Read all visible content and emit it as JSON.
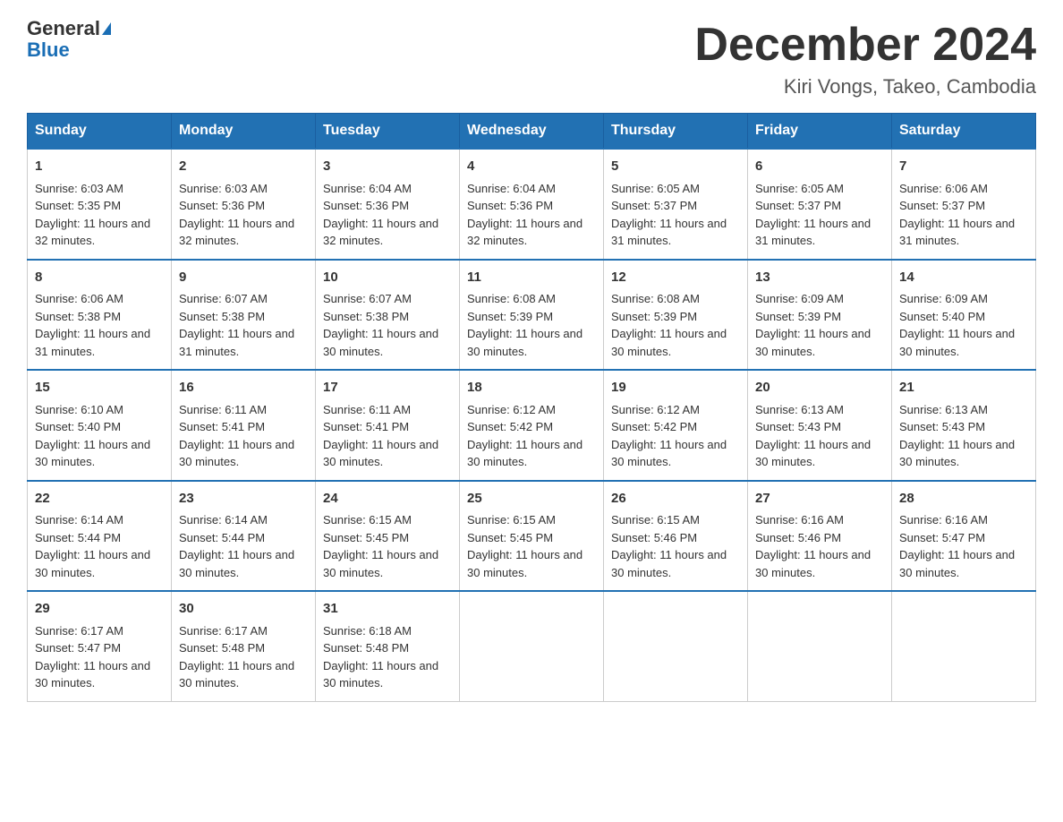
{
  "logo": {
    "line1": "General",
    "line2": "Blue"
  },
  "header": {
    "month_title": "December 2024",
    "location": "Kiri Vongs, Takeo, Cambodia"
  },
  "weekdays": [
    "Sunday",
    "Monday",
    "Tuesday",
    "Wednesday",
    "Thursday",
    "Friday",
    "Saturday"
  ],
  "weeks": [
    [
      {
        "day": "1",
        "sunrise": "6:03 AM",
        "sunset": "5:35 PM",
        "daylight": "11 hours and 32 minutes."
      },
      {
        "day": "2",
        "sunrise": "6:03 AM",
        "sunset": "5:36 PM",
        "daylight": "11 hours and 32 minutes."
      },
      {
        "day": "3",
        "sunrise": "6:04 AM",
        "sunset": "5:36 PM",
        "daylight": "11 hours and 32 minutes."
      },
      {
        "day": "4",
        "sunrise": "6:04 AM",
        "sunset": "5:36 PM",
        "daylight": "11 hours and 32 minutes."
      },
      {
        "day": "5",
        "sunrise": "6:05 AM",
        "sunset": "5:37 PM",
        "daylight": "11 hours and 31 minutes."
      },
      {
        "day": "6",
        "sunrise": "6:05 AM",
        "sunset": "5:37 PM",
        "daylight": "11 hours and 31 minutes."
      },
      {
        "day": "7",
        "sunrise": "6:06 AM",
        "sunset": "5:37 PM",
        "daylight": "11 hours and 31 minutes."
      }
    ],
    [
      {
        "day": "8",
        "sunrise": "6:06 AM",
        "sunset": "5:38 PM",
        "daylight": "11 hours and 31 minutes."
      },
      {
        "day": "9",
        "sunrise": "6:07 AM",
        "sunset": "5:38 PM",
        "daylight": "11 hours and 31 minutes."
      },
      {
        "day": "10",
        "sunrise": "6:07 AM",
        "sunset": "5:38 PM",
        "daylight": "11 hours and 30 minutes."
      },
      {
        "day": "11",
        "sunrise": "6:08 AM",
        "sunset": "5:39 PM",
        "daylight": "11 hours and 30 minutes."
      },
      {
        "day": "12",
        "sunrise": "6:08 AM",
        "sunset": "5:39 PM",
        "daylight": "11 hours and 30 minutes."
      },
      {
        "day": "13",
        "sunrise": "6:09 AM",
        "sunset": "5:39 PM",
        "daylight": "11 hours and 30 minutes."
      },
      {
        "day": "14",
        "sunrise": "6:09 AM",
        "sunset": "5:40 PM",
        "daylight": "11 hours and 30 minutes."
      }
    ],
    [
      {
        "day": "15",
        "sunrise": "6:10 AM",
        "sunset": "5:40 PM",
        "daylight": "11 hours and 30 minutes."
      },
      {
        "day": "16",
        "sunrise": "6:11 AM",
        "sunset": "5:41 PM",
        "daylight": "11 hours and 30 minutes."
      },
      {
        "day": "17",
        "sunrise": "6:11 AM",
        "sunset": "5:41 PM",
        "daylight": "11 hours and 30 minutes."
      },
      {
        "day": "18",
        "sunrise": "6:12 AM",
        "sunset": "5:42 PM",
        "daylight": "11 hours and 30 minutes."
      },
      {
        "day": "19",
        "sunrise": "6:12 AM",
        "sunset": "5:42 PM",
        "daylight": "11 hours and 30 minutes."
      },
      {
        "day": "20",
        "sunrise": "6:13 AM",
        "sunset": "5:43 PM",
        "daylight": "11 hours and 30 minutes."
      },
      {
        "day": "21",
        "sunrise": "6:13 AM",
        "sunset": "5:43 PM",
        "daylight": "11 hours and 30 minutes."
      }
    ],
    [
      {
        "day": "22",
        "sunrise": "6:14 AM",
        "sunset": "5:44 PM",
        "daylight": "11 hours and 30 minutes."
      },
      {
        "day": "23",
        "sunrise": "6:14 AM",
        "sunset": "5:44 PM",
        "daylight": "11 hours and 30 minutes."
      },
      {
        "day": "24",
        "sunrise": "6:15 AM",
        "sunset": "5:45 PM",
        "daylight": "11 hours and 30 minutes."
      },
      {
        "day": "25",
        "sunrise": "6:15 AM",
        "sunset": "5:45 PM",
        "daylight": "11 hours and 30 minutes."
      },
      {
        "day": "26",
        "sunrise": "6:15 AM",
        "sunset": "5:46 PM",
        "daylight": "11 hours and 30 minutes."
      },
      {
        "day": "27",
        "sunrise": "6:16 AM",
        "sunset": "5:46 PM",
        "daylight": "11 hours and 30 minutes."
      },
      {
        "day": "28",
        "sunrise": "6:16 AM",
        "sunset": "5:47 PM",
        "daylight": "11 hours and 30 minutes."
      }
    ],
    [
      {
        "day": "29",
        "sunrise": "6:17 AM",
        "sunset": "5:47 PM",
        "daylight": "11 hours and 30 minutes."
      },
      {
        "day": "30",
        "sunrise": "6:17 AM",
        "sunset": "5:48 PM",
        "daylight": "11 hours and 30 minutes."
      },
      {
        "day": "31",
        "sunrise": "6:18 AM",
        "sunset": "5:48 PM",
        "daylight": "11 hours and 30 minutes."
      },
      null,
      null,
      null,
      null
    ]
  ]
}
